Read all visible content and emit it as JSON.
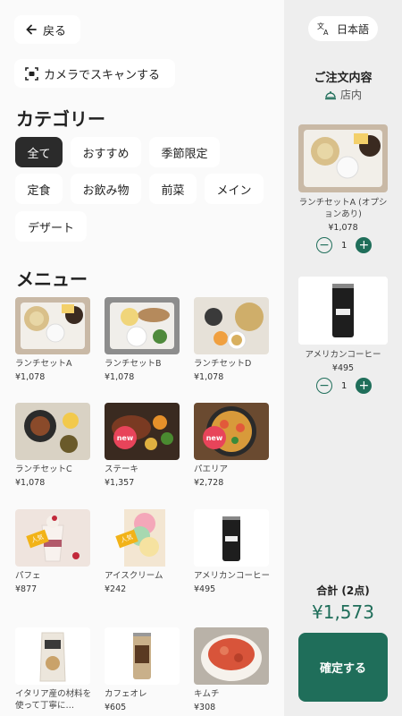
{
  "header": {
    "back_label": "戻る",
    "scan_label": "カメラでスキャンする"
  },
  "categories": {
    "title": "カテゴリー",
    "items": [
      "全て",
      "おすすめ",
      "季節限定",
      "定食",
      "お飲み物",
      "前菜",
      "メイン",
      "デザート"
    ],
    "active_index": 0
  },
  "menu": {
    "title": "メニュー",
    "items": [
      {
        "name": "ランチセットA",
        "price": "¥1,078",
        "badge": "",
        "icon": "lunch-set-image"
      },
      {
        "name": "ランチセットB",
        "price": "¥1,078",
        "badge": "",
        "icon": "lunch-set-image"
      },
      {
        "name": "ランチセットD",
        "price": "¥1,078",
        "badge": "",
        "icon": "lunch-set-image"
      },
      {
        "name": "ランチセットC",
        "price": "¥1,078",
        "badge": "",
        "icon": "lunch-set-image"
      },
      {
        "name": "ステーキ",
        "price": "¥1,357",
        "badge": "new",
        "icon": "steak-image"
      },
      {
        "name": "パエリア",
        "price": "¥2,728",
        "badge": "new",
        "icon": "paella-image"
      },
      {
        "name": "パフェ",
        "price": "¥877",
        "badge": "人気",
        "icon": "parfait-image"
      },
      {
        "name": "アイスクリーム",
        "price": "¥242",
        "badge": "人気",
        "icon": "ice-cream-image"
      },
      {
        "name": "アメリカンコーヒー",
        "price": "¥495",
        "badge": "",
        "icon": "coffee-can-image"
      },
      {
        "name": "イタリア産の材料を使って丁寧に…",
        "price": "",
        "badge": "",
        "icon": "snack-bag-image"
      },
      {
        "name": "カフェオレ",
        "price": "¥605",
        "badge": "",
        "icon": "cafe-au-lait-image"
      },
      {
        "name": "キムチ",
        "price": "¥308",
        "badge": "",
        "icon": "kimchi-image"
      }
    ]
  },
  "order": {
    "language_label": "日本語",
    "title": "ご注文内容",
    "mode_label": "店内",
    "items": [
      {
        "name": "ランチセットA (オプションあり)",
        "price": "¥1,078",
        "qty": "1"
      },
      {
        "name": "アメリカンコーヒー",
        "price": "¥495",
        "qty": "1"
      }
    ],
    "total_label": "合計 (2点)",
    "total_value": "¥1,573",
    "confirm_label": "確定する"
  },
  "colors": {
    "accent": "#1f6e5a",
    "new_badge": "#e8445a",
    "popular_badge": "#f2b318"
  }
}
